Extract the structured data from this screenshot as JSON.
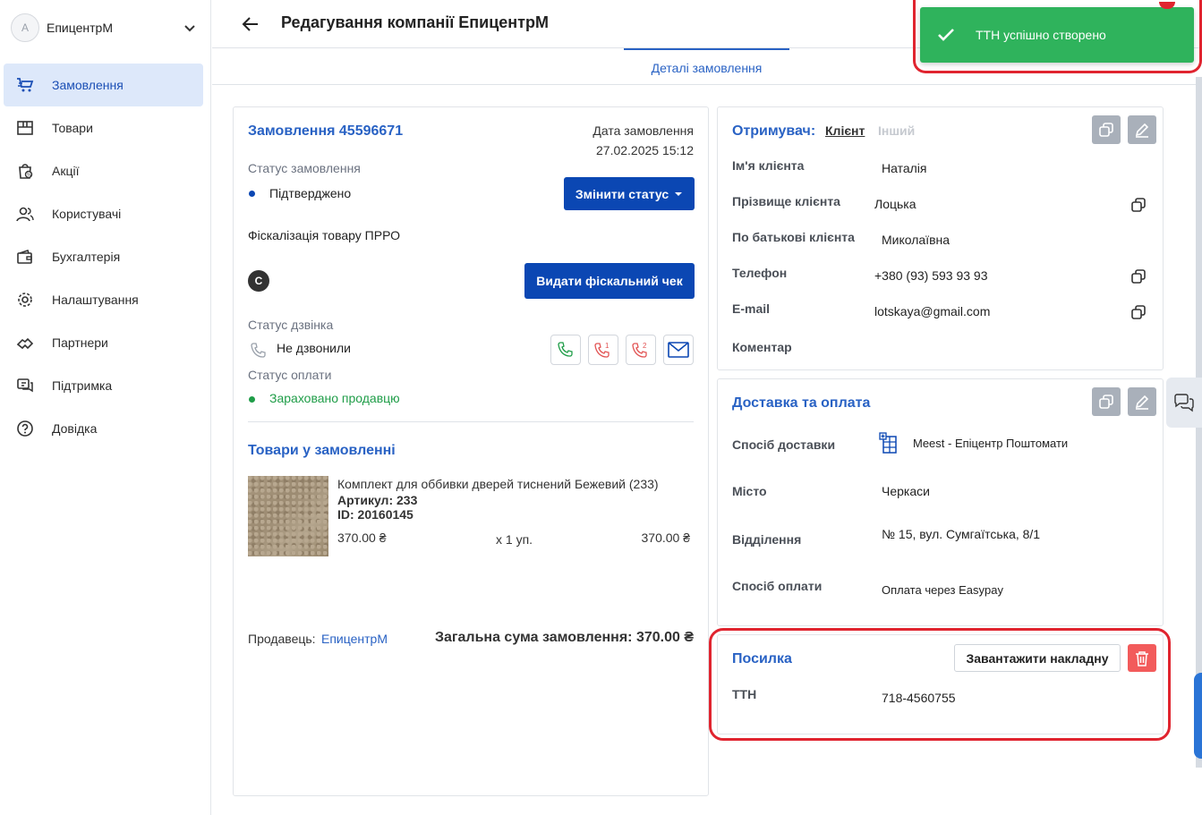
{
  "sidebar": {
    "company_initial": "А",
    "company_name": "ЕпицентрМ",
    "items": [
      {
        "label": "Замовлення",
        "icon": "cart-icon",
        "active": true
      },
      {
        "label": "Товари",
        "icon": "box-icon"
      },
      {
        "label": "Акції",
        "icon": "promo-icon"
      },
      {
        "label": "Користувачі",
        "icon": "users-icon"
      },
      {
        "label": "Бухгалтерія",
        "icon": "wallet-icon"
      },
      {
        "label": "Налаштування",
        "icon": "gear-icon"
      },
      {
        "label": "Партнери",
        "icon": "handshake-icon"
      },
      {
        "label": "Підтримка",
        "icon": "support-icon"
      },
      {
        "label": "Довідка",
        "icon": "help-icon"
      }
    ]
  },
  "header": {
    "title": "Редагування компанії ЕпицентрМ",
    "tab": "Деталі замовлення"
  },
  "toast": {
    "text": "ТТН успішно створено",
    "color": "#2fb35c"
  },
  "order": {
    "title": "Замовлення 45596671",
    "date_label": "Дата замовлення",
    "date_value": "27.02.2025 15:12",
    "status_label": "Статус замовлення",
    "status_value": "Підтверджено",
    "change_status_button": "Змінити статус",
    "fiscal_label": "Фіскалізація товару ПРРО",
    "fiscal_badge": "C",
    "fiscal_button": "Видати фіскальний чек",
    "call_status_label": "Статус дзвінка",
    "call_status_value": "Не дзвонили",
    "payment_status_label": "Статус оплати",
    "payment_status_value": "Зараховано продавцю",
    "call_count_1": "1",
    "call_count_2": "2",
    "goods_title": "Товари у замовленні",
    "product": {
      "name": "Комплект для оббивки дверей тиснений Бежевий (233)",
      "article": "Артикул: 233",
      "id": "ID: 20160145",
      "price": "370.00 ₴",
      "qty": "x 1 уп.",
      "total": "370.00 ₴"
    },
    "seller_label": "Продавець:",
    "seller_value": "ЕпицентрМ",
    "total_label": "Загальна сума замовлення: 370.00 ₴"
  },
  "recipient": {
    "title": "Отримувач:",
    "tab_client": "Клієнт",
    "tab_other": "Інший",
    "rows": [
      {
        "label": "Ім'я клієнта",
        "value": "Наталія"
      },
      {
        "label": "Прізвище клієнта",
        "value": "Лоцька"
      },
      {
        "label": "По батькові клієнта",
        "value": "Миколаївна"
      },
      {
        "label": "Телефон",
        "value": "+380 (93) 593 93 93"
      },
      {
        "label": "E-mail",
        "value": "lotskaya@gmail.com"
      },
      {
        "label": "Коментар",
        "value": ""
      }
    ]
  },
  "delivery": {
    "title": "Доставка та оплата",
    "rows": [
      {
        "label": "Спосіб доставки",
        "value": "Meest - Епіцентр Поштомати"
      },
      {
        "label": "Місто",
        "value": "Черкаси"
      },
      {
        "label": "Відділення",
        "value": "№ 15, вул. Сумгаїтська, 8/1"
      },
      {
        "label": "Спосіб оплати",
        "value": "Оплата через Easypay"
      }
    ]
  },
  "parcel": {
    "title": "Посилка",
    "download_button": "Завантажити накладну",
    "ttn_label": "ТТН",
    "ttn_value": "718-4560755"
  },
  "colors": {
    "accent": "#2962c4",
    "primary_button": "#0b47b3",
    "success": "#1f9d48",
    "danger": "#f25b5b",
    "highlight": "#e0242f"
  }
}
